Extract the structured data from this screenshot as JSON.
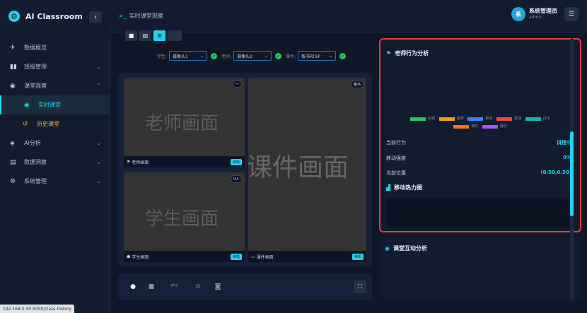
{
  "brand": {
    "name": "AI Classroom",
    "collapse_icon": "‹"
  },
  "sidebar": {
    "items": [
      {
        "icon": "rocket-icon",
        "glyph": "✈",
        "label": "数据概览",
        "chev": ""
      },
      {
        "icon": "book-icon",
        "glyph": "▮▮",
        "label": "班级管理",
        "chev": "⌄"
      },
      {
        "icon": "eye-icon",
        "glyph": "◉",
        "label": "课堂观察",
        "chev": "⌃"
      },
      {
        "icon": "record-icon",
        "glyph": "◉",
        "label": "实时课堂",
        "chev": ""
      },
      {
        "icon": "history-icon",
        "glyph": "↺",
        "label": "历史课堂",
        "chev": ""
      },
      {
        "icon": "brain-icon",
        "glyph": "◈",
        "label": "AI分析",
        "chev": "⌄"
      },
      {
        "icon": "stats-icon",
        "glyph": "▤",
        "label": "数据洞察",
        "chev": "⌄"
      },
      {
        "icon": "settings-cog-icon",
        "glyph": "⚙",
        "label": "系统管理",
        "chev": "⌄"
      }
    ]
  },
  "topbar": {
    "crumb_icon": ">_",
    "crumb": "实时课堂观察",
    "avatar": "系",
    "user_name": "系统管理员",
    "user_role": "admin",
    "settings_glyph": "☰"
  },
  "layout_buttons": [
    "■",
    "▥",
    "⊞",
    ""
  ],
  "selectors": [
    {
      "label": "学生:",
      "value": "摄像头1"
    },
    {
      "label": "老师:",
      "value": "摄像头2"
    },
    {
      "label": "课件:",
      "value": "板书RTSP"
    }
  ],
  "selector_ok": "✓",
  "selector_chev": "⌄",
  "panes": {
    "teacher": {
      "big": "老师画面",
      "label": "老师画面",
      "tag": "待机",
      "corner": "—"
    },
    "student": {
      "big": "学生画面",
      "label": "学生画面",
      "tag": "待机",
      "corner": "0人"
    },
    "courseware": {
      "big": "课件画面",
      "label": "课件画面",
      "tag": "待机",
      "corner": "板书"
    }
  },
  "controls": {
    "record": "●",
    "stop": "■",
    "signal": "ᵍᵗᵍ",
    "dot": "⊙",
    "camera": "◙",
    "fullscreen": "⛶"
  },
  "teacher_panel": {
    "title": "老师行为分析",
    "legend": [
      {
        "label": "讲授",
        "color": "#22c55e"
      },
      {
        "label": "指导",
        "color": "#f59e0b"
      },
      {
        "label": "板书",
        "color": "#3b82f6"
      },
      {
        "label": "互动",
        "color": "#ef4444"
      },
      {
        "label": "讨论",
        "color": "#14b8a6"
      },
      {
        "label": "课件",
        "color": "#f97316"
      },
      {
        "label": "展示",
        "color": "#a855f7"
      }
    ],
    "rows": [
      {
        "label": "当前行为",
        "value": "讲授中"
      },
      {
        "label": "移动强度",
        "value": "0%"
      },
      {
        "label": "当前位置",
        "value": "(0.50,0.50)"
      }
    ],
    "heat_title": "移动热力图"
  },
  "interaction_panel": {
    "title": "课堂互动分析"
  },
  "status_url": "192.168.0.50:5000/class-history"
}
